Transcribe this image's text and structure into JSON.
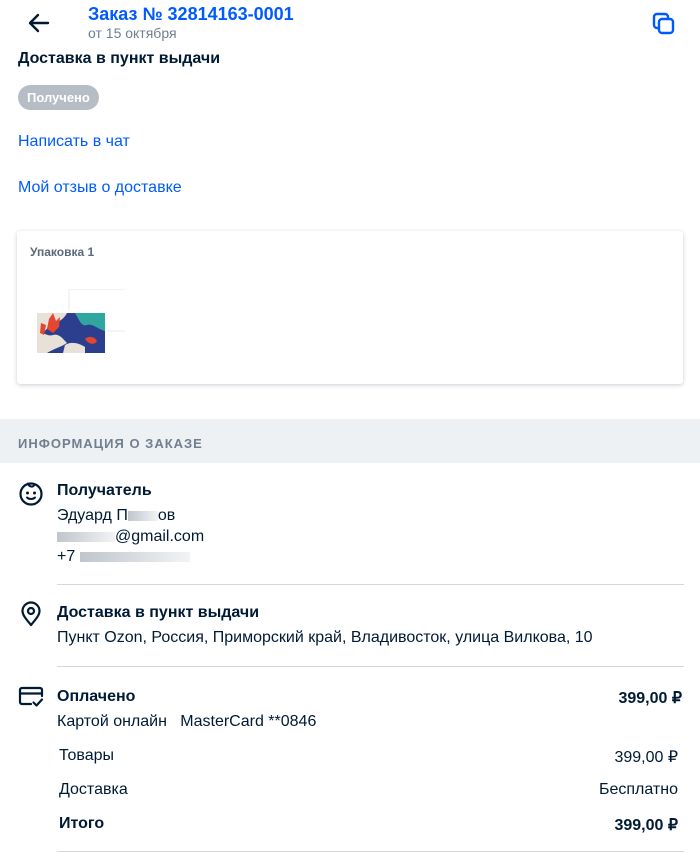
{
  "header": {
    "order_title": "Заказ № 32814163-0001",
    "order_date": "от 15 октября"
  },
  "delivery": {
    "title": "Доставка в пункт выдачи",
    "status": "Получено"
  },
  "links": {
    "chat": "Написать в чат",
    "review": "Мой отзыв о доставке"
  },
  "package": {
    "label": "Упаковка 1"
  },
  "order_info": {
    "section_title": "ИНФОРМАЦИЯ О ЗАКАЗЕ",
    "recipient": {
      "heading": "Получатель",
      "name": "Эдуард П",
      "name_tail": "ов",
      "email": "@gmail.com",
      "phone": "+7"
    },
    "pickup": {
      "heading": "Доставка в пункт выдачи",
      "address": "Пункт Ozon, Россия, Приморский край, Владивосток, улица Вилкова, 10"
    },
    "payment": {
      "heading": "Оплачено",
      "amount": "399,00 ₽",
      "method": "Картой онлайн",
      "card": "MasterCard **0846"
    },
    "summary": {
      "goods_label": "Товары",
      "goods_value": "399,00 ₽",
      "delivery_label": "Доставка",
      "delivery_value": "Бесплатно",
      "total_label": "Итого",
      "total_value": "399,00 ₽"
    }
  },
  "colors": {
    "accent": "#005bff",
    "text": "#001a34",
    "muted": "#707f8d",
    "badge": "#b7bdc5",
    "section_bg": "#eef1f4"
  },
  "icons": {
    "back": "arrow-left-icon",
    "copy": "copy-icon",
    "recipient": "smile-face-icon",
    "pickup": "location-pin-icon",
    "payment": "credit-card-check-icon"
  }
}
